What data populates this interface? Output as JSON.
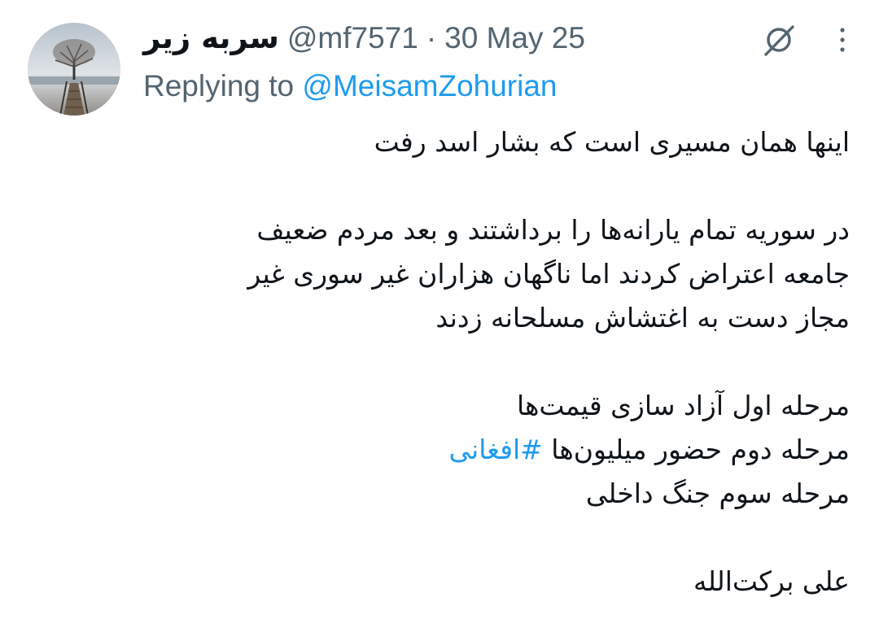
{
  "tweet": {
    "display_name": "سربه زیر",
    "handle": "@mf7571",
    "separator": "·",
    "date": "30 May 25",
    "replying_prefix": "Replying to",
    "replying_to": "@MeisamZohurian",
    "paragraph_1": {
      "line_1": "اینها همان مسیری است که بشار اسد رفت"
    },
    "paragraph_2": {
      "line_1": "در سوریه تمام یارانه‌ها را برداشتند و بعد مردم ضعیف",
      "line_2": "جامعه اعتراض کردند اما ناگهان هزاران غیر سوری غیر",
      "line_3": "مجاز دست به اغتشاش مسلحانه زدند"
    },
    "paragraph_3": {
      "line_1": "مرحله اول آزاد سازی قیمت‌ها",
      "line_2_text": "مرحله دوم حضور میلیون‌ها",
      "line_2_hashtag": "#افغانی",
      "line_3": "مرحله سوم جنگ داخلی"
    },
    "paragraph_4": {
      "line_1": "علی برکت‌الله"
    }
  },
  "icons": {
    "grok": "grok-icon",
    "more": "more-vertical-icon"
  },
  "colors": {
    "text": "#0f1419",
    "muted": "#536471",
    "link": "#1d9bf0",
    "background": "#ffffff"
  }
}
